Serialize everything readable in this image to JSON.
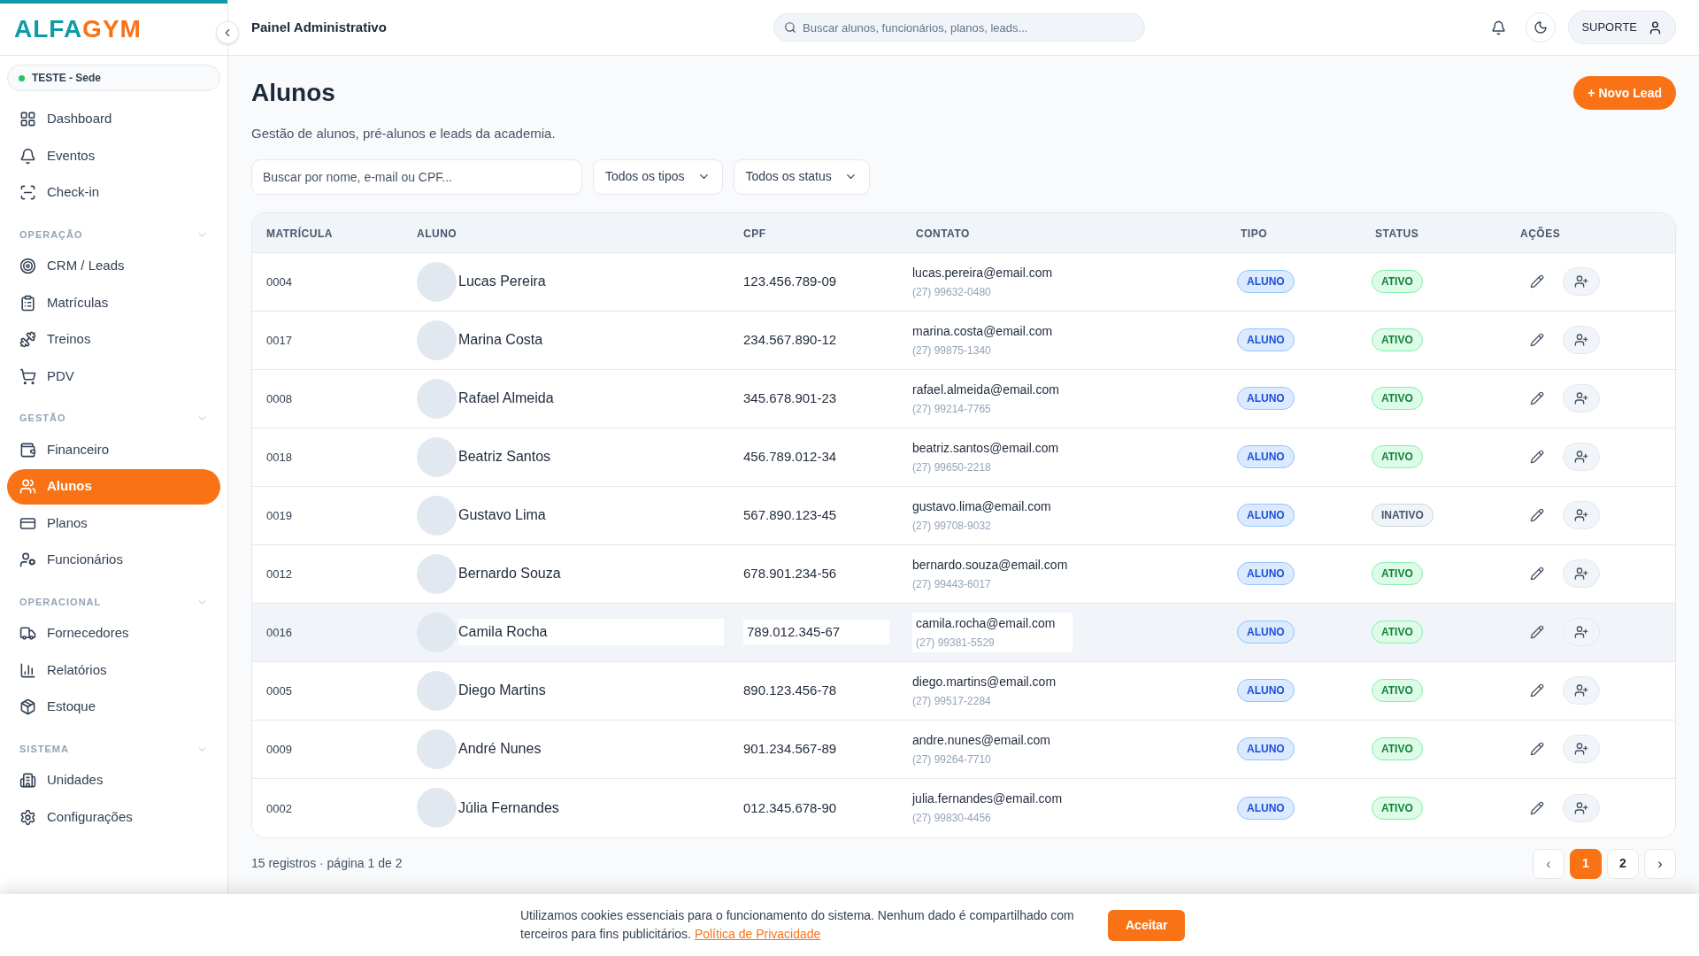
{
  "sidebar": {
    "logo": {
      "first": "ALFA",
      "second": "GYM"
    },
    "unit": {
      "label": "TESTE - Sede",
      "color": "#22c55e"
    },
    "sections": [
      {
        "items": [
          {
            "label": "Dashboard",
            "selected": false
          },
          {
            "label": "Eventos",
            "selected": false
          },
          {
            "label": "Check-in",
            "selected": false
          }
        ]
      },
      {
        "title": "OPERAÇÃO",
        "expanded": true,
        "items": [
          {
            "label": "CRM / Leads",
            "selected": false
          },
          {
            "label": "Matrículas",
            "selected": false
          },
          {
            "label": "Treinos",
            "selected": false
          },
          {
            "label": "PDV",
            "selected": false
          }
        ]
      },
      {
        "title": "GESTÃO",
        "expanded": true,
        "items": [
          {
            "label": "Financeiro",
            "selected": false
          },
          {
            "label": "Alunos",
            "selected": true
          },
          {
            "label": "Planos",
            "selected": false
          },
          {
            "label": "Funcionários",
            "selected": false
          }
        ]
      },
      {
        "title": "OPERACIONAL",
        "expanded": true,
        "items": [
          {
            "label": "Fornecedores",
            "selected": false
          },
          {
            "label": "Relatórios",
            "selected": false
          },
          {
            "label": "Estoque",
            "selected": false
          }
        ]
      },
      {
        "title": "SISTEMA",
        "expanded": true,
        "items": [
          {
            "label": "Unidades",
            "selected": false
          },
          {
            "label": "Configurações",
            "selected": false
          }
        ]
      }
    ]
  },
  "header": {
    "title": "Painel Administrativo",
    "search": {
      "placeholder": "Buscar alunos, funcionários, planos, leads..."
    },
    "support": "SUPORTE"
  },
  "page": {
    "title": "Alunos",
    "subtitle": "Gestão de alunos, pré-alunos e leads da academia.",
    "new_button": "+ Novo Lead",
    "filters": {
      "search": {
        "placeholder": "Buscar por nome, e-mail ou CPF..."
      },
      "type": "Todos os tipos",
      "status": "Todos os status"
    }
  },
  "table": {
    "columns": [
      "MATRÍCULA",
      "ALUNO",
      "CPF",
      "CONTATO",
      "TIPO",
      "STATUS",
      "AÇÕES"
    ],
    "rows": [
      {
        "id": "0004",
        "name": "Lucas Pereira",
        "cpf": "123.456.789-09",
        "email": "lucas.pereira@email.com",
        "phone": "(27) 99632-0480",
        "type": "ALUNO",
        "status": "ATIVO",
        "active": true,
        "highlighted": false
      },
      {
        "id": "0017",
        "name": "Marina Costa",
        "cpf": "234.567.890-12",
        "email": "marina.costa@email.com",
        "phone": "(27) 99875-1340",
        "type": "ALUNO",
        "status": "ATIVO",
        "active": true,
        "highlighted": false
      },
      {
        "id": "0008",
        "name": "Rafael Almeida",
        "cpf": "345.678.901-23",
        "email": "rafael.almeida@email.com",
        "phone": "(27) 99214-7765",
        "type": "ALUNO",
        "status": "ATIVO",
        "active": true,
        "highlighted": false
      },
      {
        "id": "0018",
        "name": "Beatriz Santos",
        "cpf": "456.789.012-34",
        "email": "beatriz.santos@email.com",
        "phone": "(27) 99650-2218",
        "type": "ALUNO",
        "status": "ATIVO",
        "active": true,
        "highlighted": false
      },
      {
        "id": "0019",
        "name": "Gustavo Lima",
        "cpf": "567.890.123-45",
        "email": "gustavo.lima@email.com",
        "phone": "(27) 99708-9032",
        "type": "ALUNO",
        "status": "INATIVO",
        "active": false,
        "highlighted": false
      },
      {
        "id": "0012",
        "name": "Bernardo Souza",
        "cpf": "678.901.234-56",
        "email": "bernardo.souza@email.com",
        "phone": "(27) 99443-6017",
        "type": "ALUNO",
        "status": "ATIVO",
        "active": true,
        "highlighted": false
      },
      {
        "id": "0016",
        "name": "Camila Rocha",
        "cpf": "789.012.345-67",
        "email": "camila.rocha@email.com",
        "phone": "(27) 99381-5529",
        "type": "ALUNO",
        "status": "ATIVO",
        "active": true,
        "highlighted": true
      },
      {
        "id": "0005",
        "name": "Diego Martins",
        "cpf": "890.123.456-78",
        "email": "diego.martins@email.com",
        "phone": "(27) 99517-2284",
        "type": "ALUNO",
        "status": "ATIVO",
        "active": true,
        "highlighted": false
      },
      {
        "id": "0009",
        "name": "André Nunes",
        "cpf": "901.234.567-89",
        "email": "andre.nunes@email.com",
        "phone": "(27) 99264-7710",
        "type": "ALUNO",
        "status": "ATIVO",
        "active": true,
        "highlighted": false
      },
      {
        "id": "0002",
        "name": "Júlia Fernandes",
        "cpf": "012.345.678-90",
        "email": "julia.fernandes@email.com",
        "phone": "(27) 99830-4456",
        "type": "ALUNO",
        "status": "ATIVO",
        "active": true,
        "highlighted": false
      }
    ]
  },
  "pagination": {
    "summary": "15 registros · página 1 de 2",
    "prev": "‹",
    "next": "›",
    "pages": [
      {
        "label": "1",
        "selected": true
      },
      {
        "label": "2",
        "selected": false
      }
    ]
  },
  "cookie_banner": {
    "text": "Utilizamos cookies essenciais para o funcionamento do sistema. Nenhum dado é compartilhado com terceiros para fins publicitários.",
    "link": "Política de Privacidade",
    "button": "Aceitar"
  }
}
